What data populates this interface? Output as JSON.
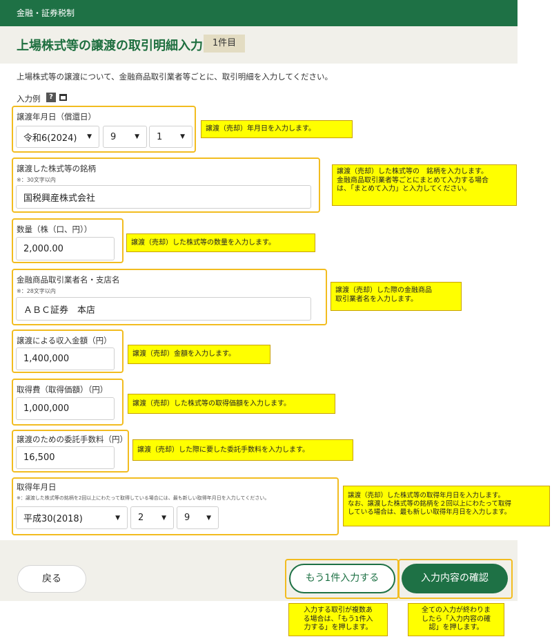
{
  "header": {
    "category": "金融・証券税制",
    "title": "上場株式等の譲渡の取引明細入力",
    "count_badge": "1件目"
  },
  "intro": "上場株式等の譲渡について、金融商品取引業者等ごとに、取引明細を入力してください。",
  "example": {
    "label": "入力例",
    "help_icon": "help-icon",
    "window_icon": "new-window-icon"
  },
  "fields": {
    "transfer_date": {
      "label": "譲渡年月日（償還日）",
      "era": "令和6(2024)",
      "month": "9",
      "day": "1"
    },
    "stock_name": {
      "label": "譲渡した株式等の銘柄",
      "note": "※：30文字以内",
      "value": "国税興産株式会社"
    },
    "quantity": {
      "label": "数量（株（口、円））",
      "value": "2,000.00"
    },
    "broker": {
      "label": "金融商品取引業者名・支店名",
      "note": "※：28文字以内",
      "value": "ＡＢＣ証券　本店"
    },
    "proceeds": {
      "label": "譲渡による収入金額（円）",
      "value": "1,400,000"
    },
    "cost": {
      "label": "取得費（取得価額）（円）",
      "value": "1,000,000"
    },
    "fee": {
      "label": "譲渡のための委託手数料（円）",
      "value": "16,500"
    },
    "acquisition_date": {
      "label": "取得年月日",
      "note": "※：譲渡した株式等の銘柄を2回以上にわたって取得している場合には、最も新しい取得年月日を入力してください。",
      "era": "平成30(2018)",
      "month": "2",
      "day": "9"
    }
  },
  "annotations": {
    "transfer_date": "譲渡（売却）年月日を入力します。",
    "stock_name": [
      "譲渡（売却）した株式等の　銘柄を入力します。",
      "金融商品取引業者等ごとにまとめて入力する場合",
      "は、「まとめて入力」と入力してください。"
    ],
    "quantity": "譲渡（売却）した株式等の数量を入力します。",
    "broker": [
      "譲渡（売却）した際の金融商品",
      "取引業者名を入力します。"
    ],
    "proceeds": "譲渡（売却）金額を入力します。",
    "cost": "譲渡（売却）した株式等の取得価額を入力します。",
    "fee": "譲渡（売却）した際に要した委託手数料を入力します。",
    "acquisition_date": [
      "譲渡（売却）した株式等の取得年月日を入力します。",
      "なお、譲渡した株式等の銘柄を２回以上にわたって取得",
      "している場合は、最も新しい取得年月日を入力します。"
    ],
    "more_button": [
      "入力する取引が複数あ",
      "る場合は、「もう1件入",
      "力する」を押します。"
    ],
    "confirm_button": [
      "全ての入力が終わりま",
      "したら「入力内容の確",
      "認」を押します。"
    ]
  },
  "buttons": {
    "back": "戻る",
    "add_another": "もう1件入力する",
    "confirm": "入力内容の確認"
  },
  "colors": {
    "header_green": "#1e7145",
    "highlight_orange": "#f2bc1f",
    "note_yellow": "#ffff00"
  }
}
